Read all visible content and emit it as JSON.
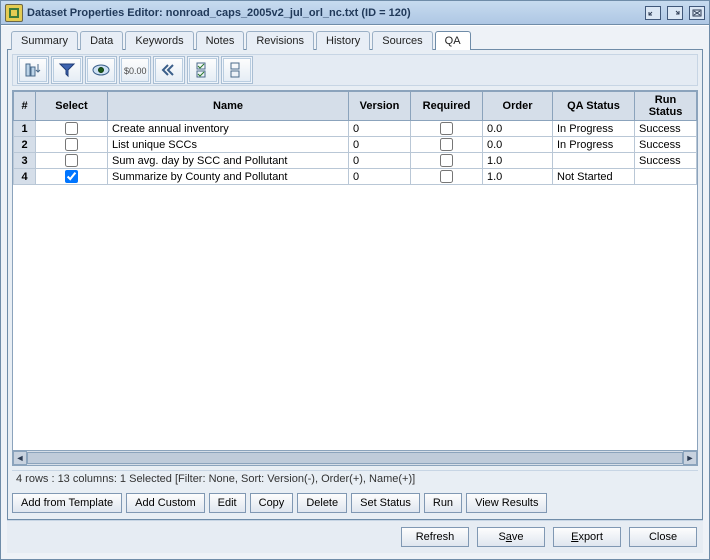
{
  "window": {
    "title": "Dataset Properties Editor: nonroad_caps_2005v2_jul_orl_nc.txt (ID = 120)"
  },
  "tabs": [
    "Summary",
    "Data",
    "Keywords",
    "Notes",
    "Revisions",
    "History",
    "Sources",
    "QA"
  ],
  "active_tab": "QA",
  "columns": [
    "#",
    "Select",
    "Name",
    "Version",
    "Required",
    "Order",
    "QA Status",
    "Run Status"
  ],
  "rows": [
    {
      "n": "1",
      "select": false,
      "name": "Create annual inventory",
      "version": "0",
      "required": false,
      "order": "0.0",
      "qa_status": "In Progress",
      "run_status": "Success"
    },
    {
      "n": "2",
      "select": false,
      "name": "List unique SCCs",
      "version": "0",
      "required": false,
      "order": "0.0",
      "qa_status": "In Progress",
      "run_status": "Success"
    },
    {
      "n": "3",
      "select": false,
      "name": "Sum avg. day by SCC and Pollutant",
      "version": "0",
      "required": false,
      "order": "1.0",
      "qa_status": "",
      "run_status": "Success"
    },
    {
      "n": "4",
      "select": true,
      "name": "Summarize by County and Pollutant",
      "version": "0",
      "required": false,
      "order": "1.0",
      "qa_status": "Not Started",
      "run_status": ""
    }
  ],
  "status_text": "4 rows : 13 columns: 1 Selected [Filter: None, Sort: Version(-), Order(+), Name(+)]",
  "qa_buttons": {
    "add_template": "Add from Template",
    "add_custom": "Add Custom",
    "edit": "Edit",
    "copy": "Copy",
    "delete": "Delete",
    "set_status": "Set Status",
    "run": "Run",
    "view_results": "View Results"
  },
  "footer": {
    "refresh": "Refresh",
    "save_pre": "S",
    "save_u": "a",
    "save_post": "ve",
    "export_pre": "",
    "export_u": "E",
    "export_post": "xport",
    "close": "Close"
  }
}
